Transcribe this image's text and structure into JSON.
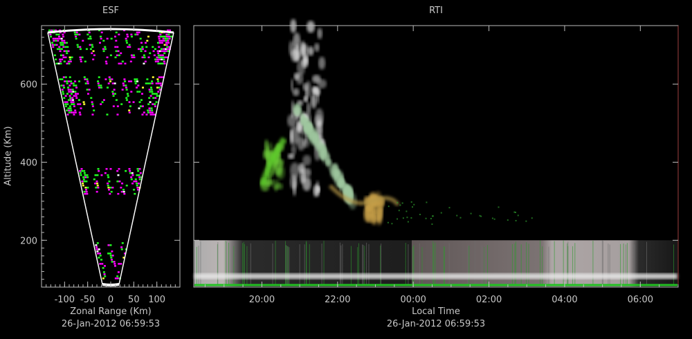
{
  "chart_data": [
    {
      "type": "scatter",
      "title": "ESF",
      "xlabel": "Zonal Range (Km)",
      "ylabel": "Altitude (Km)",
      "footer": "26-Jan-2012 06:59:53",
      "xlim": [
        -150,
        150
      ],
      "ylim": [
        80,
        750
      ],
      "x_ticks": [
        -100,
        -50,
        0,
        50,
        100
      ],
      "x_tick_labels": [
        "-100",
        "-50",
        "0",
        "50",
        "100"
      ],
      "y_ticks": [
        200,
        400,
        600
      ],
      "y_tick_labels": [
        "200",
        "400",
        "600"
      ],
      "echo_bands_km": [
        [
          650,
          740
        ],
        [
          520,
          620
        ],
        [
          320,
          385
        ],
        [
          100,
          195
        ]
      ],
      "colors": {
        "echo_1": "#ff00ff",
        "echo_2": "#22ff22",
        "echo_3": "#ffffff",
        "echo_4": "#ffff33"
      }
    },
    {
      "type": "heatmap",
      "title": "RTI",
      "xlabel": "Local Time",
      "footer": "26-Jan-2012 06:59:53",
      "x_tick_labels": [
        "20:00",
        "22:00",
        "00:00",
        "02:00",
        "04:00",
        "06:00"
      ],
      "x_ticks_hours": [
        20,
        22,
        24,
        26,
        28,
        30
      ],
      "xlim_hours": [
        18.2,
        31.0
      ],
      "ylim": [
        80,
        750
      ],
      "y_ticks": [
        200,
        400,
        600
      ],
      "plumes": [
        {
          "t_start": 20.4,
          "t_end": 21.6,
          "alt_low": 320,
          "alt_high": 750,
          "color": "#e6e6e6"
        },
        {
          "t_start": 20.9,
          "t_end": 22.4,
          "alt_low": 300,
          "alt_high": 600,
          "color": "#9fc79f"
        },
        {
          "t_start": 19.9,
          "t_end": 20.5,
          "alt_low": 330,
          "alt_high": 440,
          "color": "#6fcf3a"
        },
        {
          "t_start": 22.6,
          "t_end": 23.2,
          "alt_low": 250,
          "alt_high": 310,
          "color": "#c8a04a"
        }
      ],
      "low_layer": {
        "alt_low": 80,
        "alt_high": 200
      }
    }
  ]
}
